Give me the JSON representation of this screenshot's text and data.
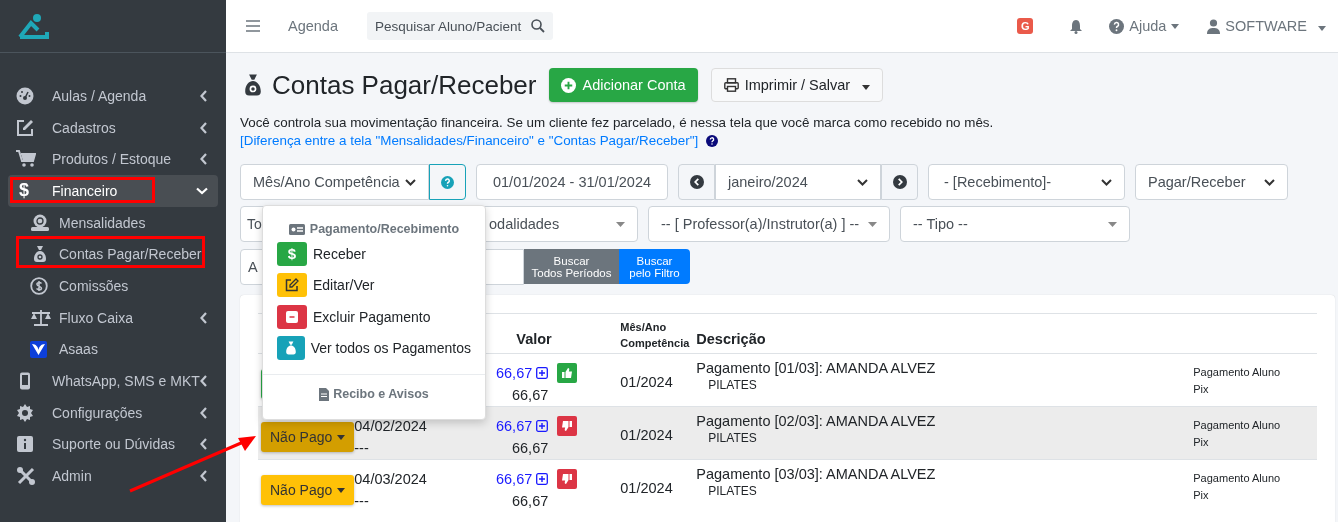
{
  "sidebar": {
    "items": [
      {
        "label": "Aulas / Agenda",
        "expanded": false,
        "selected": false
      },
      {
        "label": "Cadastros",
        "expanded": false,
        "selected": false
      },
      {
        "label": "Produtos / Estoque",
        "expanded": false,
        "selected": false
      },
      {
        "label": "Financeiro",
        "glyph": "$",
        "expanded": true,
        "selected": true,
        "children": [
          {
            "label": "Mensalidades"
          },
          {
            "label": "Contas Pagar/Receber"
          },
          {
            "label": "Comissões"
          },
          {
            "label": "Fluxo Caixa",
            "expanded": false
          },
          {
            "label": "Asaas"
          }
        ]
      },
      {
        "label": "WhatsApp, SMS e MKT",
        "expanded": false,
        "selected": false
      },
      {
        "label": "Configurações",
        "expanded": false,
        "selected": false
      },
      {
        "label": "Suporte ou Dúvidas",
        "expanded": false,
        "selected": false
      },
      {
        "label": "Admin",
        "expanded": false,
        "selected": false
      }
    ]
  },
  "navbar": {
    "link": "Agenda",
    "search": {
      "placeholder": "Pesquisar Aluno/Pacient"
    },
    "badge": "G",
    "help": "Ajuda",
    "user": "SOFTWARE"
  },
  "page": {
    "title": "Contas Pagar/Receber",
    "buttons": [
      "Adicionar Conta",
      "Imprimir / Salvar"
    ],
    "description": "Você controla sua movimentação financeira. Se um cliente fez parcelado, é nessa tela que você marca como recebido no mês.",
    "help_link": "[Diferença entre a tela \"Mensalidades/Financeiro\" e \"Contas Pagar/Receber\"]"
  },
  "filters": {
    "competencia": "Mês/Ano Competência",
    "period": "01/01/2024 - 31/01/2024",
    "month": "janeiro/2024",
    "recebimento": "- [Recebimento]-",
    "pagar_receber": "Pagar/Receber",
    "field_1": "To",
    "modalidades": "odalidades",
    "professor": "-- [ Professor(a)/Instrutor(a) ] --",
    "tipo": "-- Tipo --",
    "field_2": "A",
    "buttons": [
      "Buscar\nTodos Períodos",
      "Buscar\npelo Filtro"
    ]
  },
  "table": {
    "columns": [
      "Valor",
      "Mês/Ano\nCompetência",
      "Descrição"
    ],
    "rows": [
      {
        "status": {
          "kind": "paid"
        },
        "highlighted": false,
        "value_link": "66,67",
        "value": "66,67",
        "approved": true,
        "competencia": "01/2024",
        "description": "Pagamento [01/03]: AMANDA ALVEZ",
        "modality": "PILATES",
        "note": [
          "Pagamento Aluno",
          "Pix"
        ]
      },
      {
        "status": {
          "kind": "unpaid",
          "label": "Não Pago"
        },
        "date": "04/02/2024",
        "date_2": "---",
        "highlighted": true,
        "value_link": "66,67",
        "value": "66,67",
        "approved": false,
        "competencia": "01/2024",
        "description": "Pagamento [02/03]: AMANDA ALVEZ",
        "modality": "PILATES",
        "note": [
          "Pagamento Aluno",
          "Pix"
        ]
      },
      {
        "status": {
          "kind": "unpaid",
          "label": "Não Pago"
        },
        "date": "04/03/2024",
        "date_2": "---",
        "highlighted": false,
        "value_link": "66,67",
        "value": "66,67",
        "approved": false,
        "competencia": "01/2024",
        "description": "Pagamento [03/03]: AMANDA ALVEZ",
        "modality": "PILATES",
        "note": [
          "Pagamento Aluno",
          "Pix"
        ]
      }
    ]
  },
  "menu": {
    "header": "Pagamento/Recebimento",
    "items": [
      {
        "label": "Receber",
        "color": "#28a745",
        "glyph": "$"
      },
      {
        "label": "Editar/Ver",
        "color": "#ffc107"
      },
      {
        "label": "Excluir Pagamento",
        "color": "#dc3545"
      },
      {
        "label": "Ver todos os Pagamentos",
        "color": "#17a2b8"
      }
    ],
    "footer": "Recibo e Avisos"
  }
}
